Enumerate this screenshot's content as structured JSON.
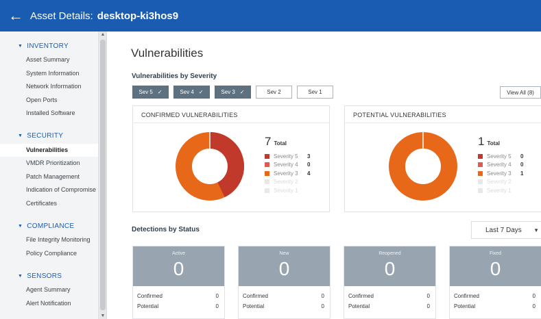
{
  "header": {
    "back_icon": "arrow-left-icon",
    "title_prefix": "Asset Details:",
    "asset_name": "desktop-ki3hos9",
    "bar_color": "#1b5cb3"
  },
  "sidebar": {
    "sections": [
      {
        "title": "INVENTORY",
        "items": [
          "Asset Summary",
          "System Information",
          "Network Information",
          "Open Ports",
          "Installed Software"
        ]
      },
      {
        "title": "SECURITY",
        "items": [
          "Vulnerabilities",
          "VMDR Prioritization",
          "Patch Management",
          "Indication of Compromise",
          "Certificates"
        ]
      },
      {
        "title": "COMPLIANCE",
        "items": [
          "File Integrity Monitoring",
          "Policy Compliance"
        ]
      },
      {
        "title": "SENSORS",
        "items": [
          "Agent Summary",
          "Alert Notification"
        ]
      }
    ],
    "active_item": "Vulnerabilities"
  },
  "main": {
    "page_title": "Vulnerabilities",
    "by_severity_title": "Vulnerabilities by Severity",
    "severity_filters": [
      {
        "label": "Sev 5",
        "checked": true
      },
      {
        "label": "Sev 4",
        "checked": true
      },
      {
        "label": "Sev 3",
        "checked": true
      },
      {
        "label": "Sev 2",
        "checked": false
      },
      {
        "label": "Sev 1",
        "checked": false
      }
    ],
    "view_all_label": "View All (8)",
    "confirmed": {
      "title": "CONFIRMED VULNERABILITIES",
      "total": "7",
      "total_label": "Total",
      "legend": [
        {
          "label": "Severity 5",
          "value": "3",
          "color": "#c0392b"
        },
        {
          "label": "Severity 4",
          "value": "0",
          "color": "#e05a4f"
        },
        {
          "label": "Severity 3",
          "value": "4",
          "color": "#e8681a"
        },
        {
          "label": "Severity 2",
          "value": "",
          "color": "#e8e8e8"
        },
        {
          "label": "Severity 1",
          "value": "",
          "color": "#e8e8e8"
        }
      ]
    },
    "potential": {
      "title": "POTENTIAL VULNERABILITIES",
      "total": "1",
      "total_label": "Total",
      "legend": [
        {
          "label": "Severity 5",
          "value": "0",
          "color": "#c0392b"
        },
        {
          "label": "Severity 4",
          "value": "0",
          "color": "#e05a4f"
        },
        {
          "label": "Severity 3",
          "value": "1",
          "color": "#e8681a"
        },
        {
          "label": "Severity 2",
          "value": "",
          "color": "#e8e8e8"
        },
        {
          "label": "Severity 1",
          "value": "",
          "color": "#e8e8e8"
        }
      ]
    },
    "detections_title": "Detections by Status",
    "period": "Last 7 Days",
    "status_cards": [
      {
        "label": "Active",
        "count": "0",
        "confirmed_label": "Confirmed",
        "confirmed": "0",
        "potential_label": "Potential",
        "potential": "0"
      },
      {
        "label": "New",
        "count": "0",
        "confirmed_label": "Confirmed",
        "confirmed": "0",
        "potential_label": "Potential",
        "potential": "0"
      },
      {
        "label": "Reopened",
        "count": "0",
        "confirmed_label": "Confirmed",
        "confirmed": "0",
        "potential_label": "Potential",
        "potential": "0"
      },
      {
        "label": "Fixed",
        "count": "0",
        "confirmed_label": "Confirmed",
        "confirmed": "0",
        "potential_label": "Potential",
        "potential": "0"
      }
    ]
  }
}
